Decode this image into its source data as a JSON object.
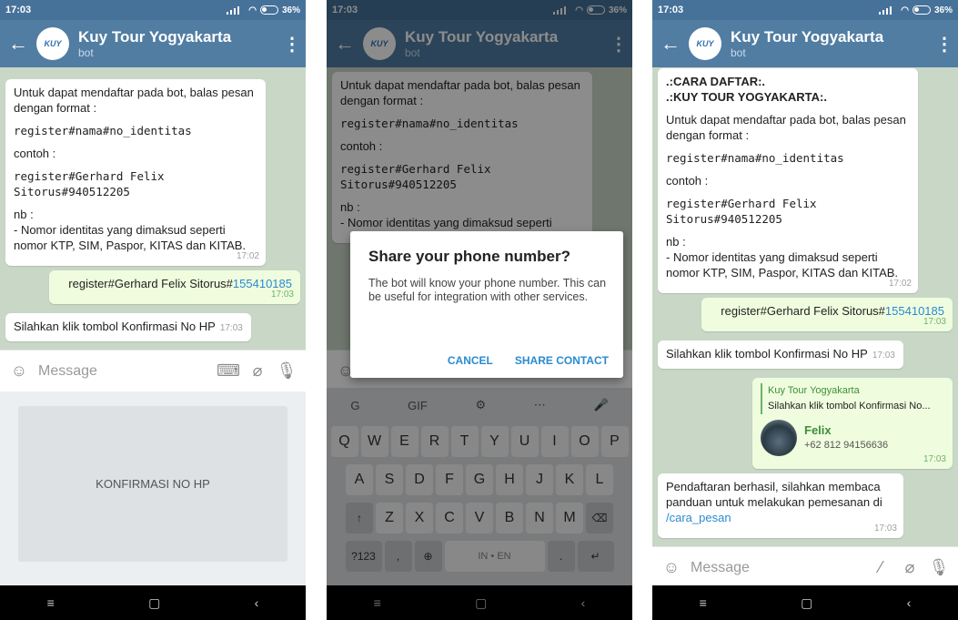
{
  "status": {
    "time": "17:03",
    "battery": "36%"
  },
  "header": {
    "title": "Kuy Tour Yogyakarta",
    "subtitle": "bot",
    "avatar_text": "KUY"
  },
  "screens": {
    "one": {
      "messages": {
        "info": [
          "Untuk dapat mendaftar pada bot, balas pesan dengan format :",
          "register#nama#no_identitas",
          "contoh :",
          "register#Gerhard Felix Sitorus#940512205",
          "nb :",
          "- Nomor identitas yang dimaksud seperti nomor KTP, SIM, Paspor, KITAS dan KITAB."
        ],
        "info_time": "17:02",
        "outgoing_prefix": "register#Gerhard Felix Sitorus#",
        "outgoing_link": "155410185",
        "outgoing_time": "17:03",
        "reply": "Silahkan klik tombol Konfirmasi No HP",
        "reply_time": "17:03"
      },
      "composer_placeholder": "Message",
      "keyboard_button": "KONFIRMASI NO HP"
    },
    "two": {
      "messages": {
        "info": [
          "Untuk dapat mendaftar pada bot, balas pesan dengan format :",
          "register#nama#no_identitas",
          "contoh :",
          "register#Gerhard Felix Sitorus#940512205",
          "nb :",
          "- Nomor identitas yang dimaksud seperti"
        ]
      },
      "dialog": {
        "title": "Share your phone number?",
        "body": "The bot will know your phone number. This can be useful for integration with other services.",
        "cancel": "CANCEL",
        "share": "SHARE CONTACT"
      },
      "keyboard": {
        "tools": [
          "G",
          "GIF",
          "⚙",
          "⋯",
          "🎤"
        ],
        "row1": [
          "Q",
          "W",
          "E",
          "R",
          "T",
          "Y",
          "U",
          "I",
          "O",
          "P"
        ],
        "row2": [
          "A",
          "S",
          "D",
          "F",
          "G",
          "H",
          "J",
          "K",
          "L"
        ],
        "row3": [
          "Z",
          "X",
          "C",
          "V",
          "B",
          "N",
          "M"
        ],
        "num": "?123",
        "lang": "IN • EN"
      }
    },
    "three": {
      "messages": {
        "header_line1": ".:CARA DAFTAR:.",
        "header_line2": ".:KUY TOUR YOGYAKARTA:.",
        "info": [
          "Untuk dapat mendaftar pada bot, balas pesan dengan format :",
          "register#nama#no_identitas",
          "contoh :",
          "register#Gerhard Felix Sitorus#940512205",
          "nb :",
          "- Nomor identitas yang dimaksud seperti nomor KTP, SIM, Paspor, KITAS dan KITAB."
        ],
        "info_time": "17:02",
        "outgoing_prefix": "register#Gerhard Felix Sitorus#",
        "outgoing_link": "155410185",
        "outgoing_time": "17:03",
        "reply": "Silahkan klik tombol Konfirmasi No HP",
        "reply_time": "17:03",
        "quote_name": "Kuy Tour Yogyakarta",
        "quote_text": "Silahkan klik tombol Konfirmasi No...",
        "contact_name": "Felix",
        "contact_phone": "+62 812 94156636",
        "contact_time": "17:03",
        "success": "Pendaftaran berhasil, silahkan membaca panduan untuk melakukan pemesanan di ",
        "success_link": "/cara_pesan",
        "success_time": "17:03"
      },
      "composer_placeholder": "Message"
    }
  },
  "colors": {
    "appbar": "#517da2",
    "chat_bg": "#c8d7c6",
    "link": "#2a8bd0"
  }
}
